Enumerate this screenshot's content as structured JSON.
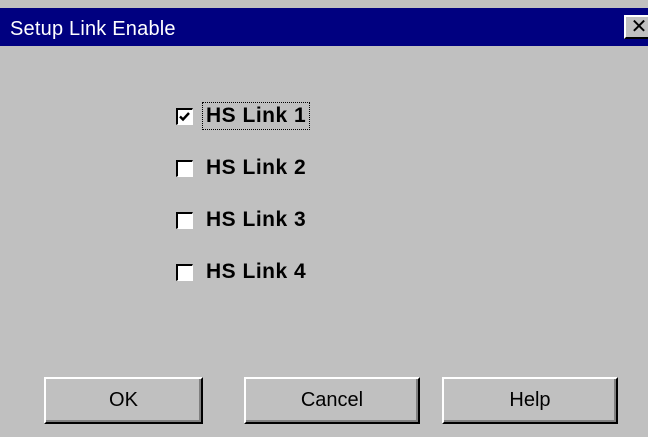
{
  "window": {
    "title": "Setup Link Enable",
    "close_glyph": "✕"
  },
  "links": [
    {
      "label": "HS Link 1",
      "checked": true,
      "focused": true
    },
    {
      "label": "HS Link 2",
      "checked": false,
      "focused": false
    },
    {
      "label": "HS Link 3",
      "checked": false,
      "focused": false
    },
    {
      "label": "HS Link 4",
      "checked": false,
      "focused": false
    }
  ],
  "buttons": {
    "ok_label": "OK",
    "cancel_label": "Cancel",
    "help_label": "Help"
  },
  "colors": {
    "titlebar": "#000080",
    "face": "#c0c0c0"
  }
}
